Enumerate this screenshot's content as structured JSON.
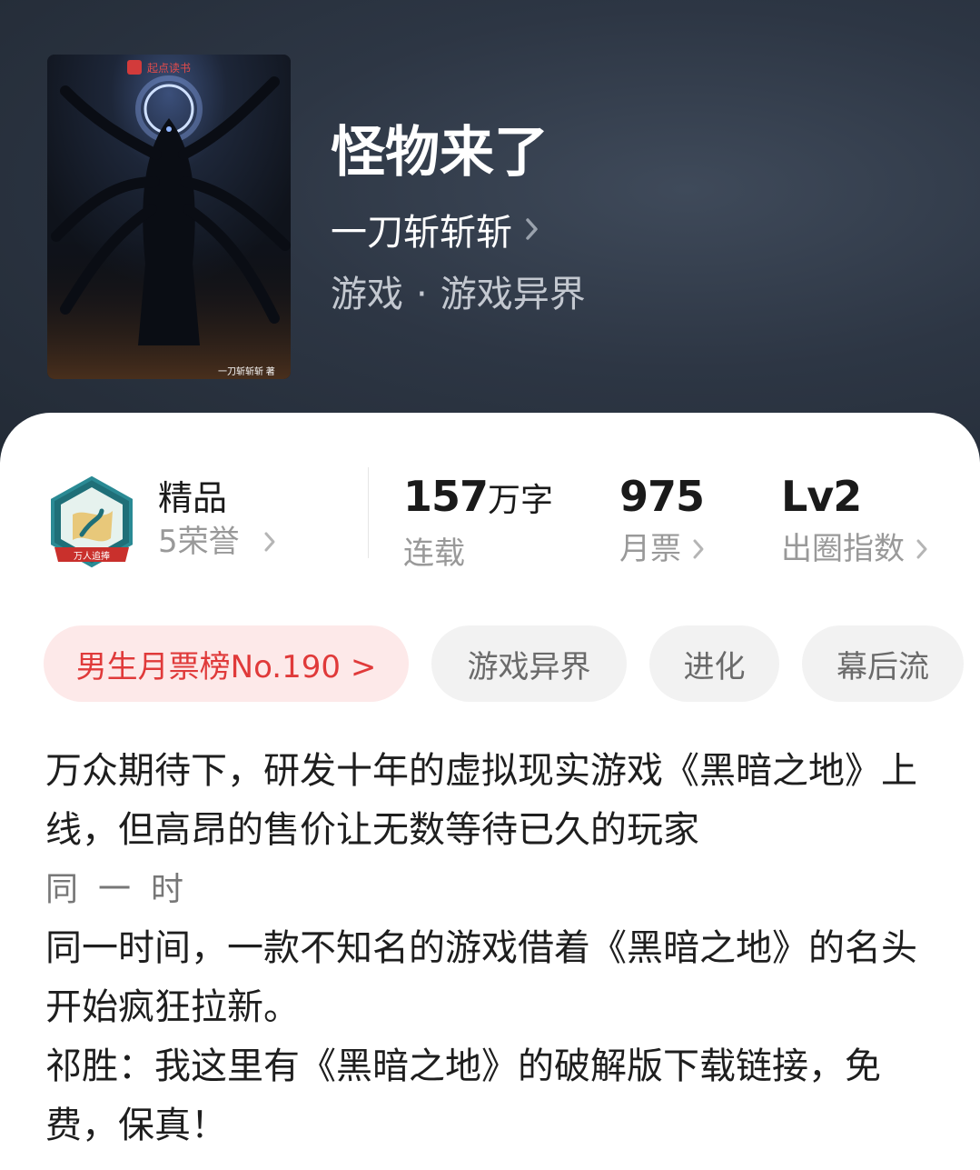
{
  "book": {
    "title": "怪物来了",
    "author": "一刀斩斩斩",
    "genre_main": "游戏",
    "genre_separator": "·",
    "genre_sub": "游戏异界",
    "cover": {
      "publisher": "起点读书",
      "author_credit": "一刀斩斩斩 著"
    }
  },
  "stats": {
    "quality_label": "精品",
    "honors": "5荣誉",
    "badge_text": "万人追捧",
    "word_count_number": "157",
    "word_count_unit": "万字",
    "status": "连载",
    "monthly_tickets": "975",
    "monthly_tickets_label": "月票",
    "level": "Lv2",
    "level_label": "出圈指数"
  },
  "tags": [
    {
      "label": "男生月票榜No.190 >"
    },
    {
      "label": "游戏异界"
    },
    {
      "label": "进化"
    },
    {
      "label": "幕后流"
    }
  ],
  "description": {
    "para1": "万众期待下，研发十年的虚拟现实游戏《黑暗之地》上线，但高昂的售价让无数等待已久的玩家",
    "cut_line": "同一时间，",
    "para2": "同一时间，一款不知名的游戏借着《黑暗之地》的名头开始疯狂拉新。",
    "para3": "祁胜：我这里有《黑暗之地》的破解版下载链接，免费，保真！"
  },
  "colors": {
    "header_bg": "#2d3644",
    "rank_tag_bg": "#fde9e9",
    "rank_tag_text": "#e03a3a",
    "tag_bg": "#f2f2f2"
  }
}
